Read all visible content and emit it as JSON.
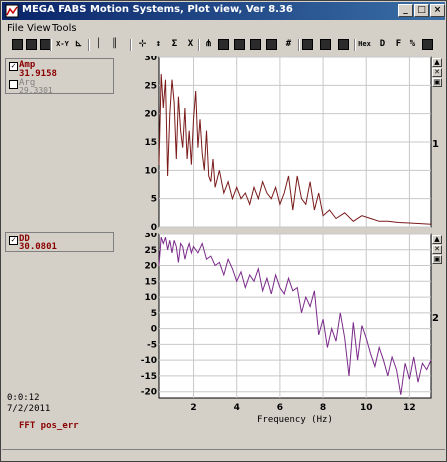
{
  "window": {
    "title": "MEGA FABS Motion Systems, Plot view, Ver 8.36",
    "minimize_glyph": "_",
    "maximize_glyph": "□",
    "close_glyph": "×"
  },
  "menu": {
    "items": [
      {
        "label": "File"
      },
      {
        "label": "View"
      },
      {
        "label": "Tools"
      }
    ]
  },
  "toolbar": {
    "tools": [
      {
        "icon": "print-icon"
      },
      {
        "icon": "save-icon"
      },
      {
        "icon": "chart-icon"
      },
      {
        "icon": "xy-icon",
        "glyph": "X-Y"
      },
      {
        "icon": "axis-icon",
        "glyph": "⊾"
      },
      {
        "icon": "vline-icon",
        "glyph": "│"
      },
      {
        "icon": "vline2-icon",
        "glyph": "║"
      },
      {
        "icon": "cursor-icon",
        "glyph": "⊹"
      },
      {
        "icon": "zoom-x-icon",
        "glyph": "↕"
      },
      {
        "icon": "zoom-icon",
        "glyph": "Σ"
      },
      {
        "icon": "delete-icon",
        "glyph": "X"
      },
      {
        "icon": "fft-icon",
        "glyph": "⋔"
      },
      {
        "icon": "scale-icon"
      },
      {
        "icon": "table-icon"
      },
      {
        "icon": "image-icon"
      },
      {
        "icon": "screen-icon"
      },
      {
        "icon": "grid-icon",
        "glyph": "#"
      },
      {
        "icon": "layout-icon"
      },
      {
        "icon": "printer-icon"
      },
      {
        "icon": "bar-icon"
      },
      {
        "icon": "hex-icon",
        "glyph": "Hex"
      },
      {
        "icon": "decimal-icon",
        "glyph": "D"
      },
      {
        "icon": "float-icon",
        "glyph": "F"
      },
      {
        "icon": "percent-icon",
        "glyph": "%"
      },
      {
        "icon": "split-icon"
      }
    ]
  },
  "channels": [
    {
      "name": "Amp",
      "value": "31.9158",
      "checked": true
    },
    {
      "name": "Arg",
      "value": "29.3301",
      "checked": false
    },
    {
      "name": "DD",
      "value": "30.0801",
      "checked": true
    }
  ],
  "footer": {
    "time": "0:0:12",
    "date": "7/2/2011",
    "fft_label": "FFT  pos_err"
  },
  "plots": {
    "plot1_number": "1",
    "plot2_number": "2",
    "xlabel": "Frequency (Hz)"
  },
  "side_buttons": [
    "▲",
    "✕",
    "▣"
  ],
  "chart_data": [
    {
      "type": "line",
      "xlabel": "Frequency (Hz)",
      "ylabel": "",
      "xlim": [
        0.4,
        13
      ],
      "ylim": [
        0,
        30
      ],
      "x_ticks": [
        2,
        4,
        6,
        8,
        10,
        12
      ],
      "y_ticks": [
        0,
        5,
        10,
        15,
        20,
        25,
        30
      ],
      "grid": true,
      "color": "#7a1a1a",
      "series": [
        {
          "name": "Amp",
          "x": [
            0.4,
            0.5,
            0.6,
            0.7,
            0.8,
            0.9,
            1.0,
            1.1,
            1.2,
            1.3,
            1.4,
            1.5,
            1.6,
            1.7,
            1.8,
            1.9,
            2.0,
            2.1,
            2.2,
            2.3,
            2.4,
            2.5,
            2.6,
            2.7,
            2.8,
            2.9,
            3.0,
            3.2,
            3.4,
            3.6,
            3.8,
            4.0,
            4.2,
            4.4,
            4.6,
            4.8,
            5.0,
            5.2,
            5.4,
            5.6,
            5.8,
            6.0,
            6.2,
            6.4,
            6.6,
            6.8,
            7.0,
            7.2,
            7.4,
            7.6,
            7.8,
            8.0,
            8.3,
            8.6,
            9.0,
            9.4,
            9.8,
            10.2,
            10.6,
            11.0,
            11.5,
            12.0,
            12.5,
            13.0
          ],
          "y": [
            11,
            27,
            21,
            26,
            9,
            20,
            26,
            22,
            12,
            23,
            17,
            14,
            21,
            12,
            17,
            11,
            19,
            24,
            14,
            19,
            13,
            10,
            17,
            9,
            8,
            12,
            7,
            10,
            6,
            8,
            5,
            7,
            5,
            6,
            4,
            7,
            5,
            8,
            6,
            5,
            7,
            4,
            6,
            9,
            3,
            9,
            5,
            4,
            8,
            3,
            6,
            2,
            3,
            1.5,
            2.5,
            1,
            2,
            1.5,
            1,
            1,
            0.8,
            0.7,
            0.6,
            0.5
          ]
        }
      ]
    },
    {
      "type": "line",
      "xlabel": "Frequency (Hz)",
      "ylabel": "",
      "xlim": [
        0.4,
        13
      ],
      "ylim": [
        -22,
        30
      ],
      "x_ticks": [
        2,
        4,
        6,
        8,
        10,
        12
      ],
      "y_ticks": [
        -20,
        -15,
        -10,
        -5,
        0,
        5,
        10,
        15,
        20,
        25,
        30
      ],
      "grid": true,
      "color": "#7a2a8a",
      "series": [
        {
          "name": "DD",
          "x": [
            0.4,
            0.5,
            0.6,
            0.7,
            0.8,
            0.9,
            1.0,
            1.1,
            1.2,
            1.3,
            1.4,
            1.5,
            1.6,
            1.7,
            1.8,
            1.9,
            2.0,
            2.2,
            2.4,
            2.6,
            2.8,
            3.0,
            3.2,
            3.4,
            3.6,
            3.8,
            4.0,
            4.2,
            4.4,
            4.6,
            4.8,
            5.0,
            5.2,
            5.4,
            5.6,
            5.8,
            6.0,
            6.2,
            6.4,
            6.6,
            6.8,
            7.0,
            7.2,
            7.4,
            7.6,
            7.8,
            8.0,
            8.2,
            8.4,
            8.6,
            8.8,
            9.0,
            9.2,
            9.4,
            9.6,
            9.8,
            10.0,
            10.2,
            10.4,
            10.6,
            10.8,
            11.0,
            11.2,
            11.4,
            11.6,
            11.8,
            12.0,
            12.2,
            12.4,
            12.6,
            12.8,
            13.0
          ],
          "y": [
            20,
            29,
            27,
            29,
            25,
            28,
            24,
            28,
            26,
            21,
            27,
            26,
            22,
            25,
            27,
            24,
            26,
            24,
            27,
            22,
            23,
            20,
            21,
            17,
            22,
            19,
            15,
            18,
            13,
            17,
            15,
            19,
            12,
            16,
            11,
            17,
            13,
            11,
            16,
            12,
            13,
            5,
            10,
            7,
            12,
            -2,
            3,
            -6,
            0,
            -4,
            5,
            -3,
            -15,
            2,
            -10,
            1,
            -3,
            -8,
            -12,
            -6,
            -10,
            -15,
            -9,
            -13,
            -21,
            -11,
            -16,
            -9,
            -17,
            -11,
            -13,
            -10
          ]
        }
      ]
    }
  ]
}
